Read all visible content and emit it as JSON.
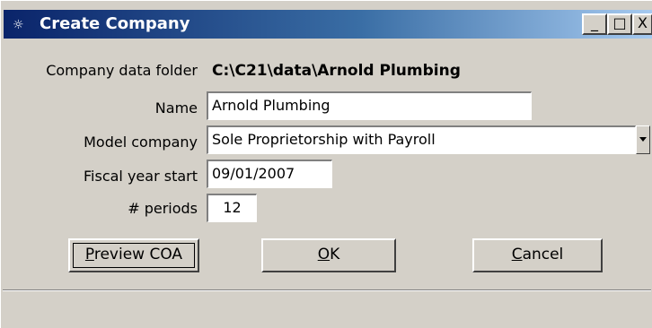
{
  "window": {
    "title": "Create Company",
    "icon": "sage-app-icon",
    "controls": {
      "minimize": "_",
      "maximize": "□",
      "close": "X"
    }
  },
  "form": {
    "folder_label": "Company data folder",
    "folder_value": "C:\\C21\\data\\Arnold Plumbing",
    "name_label": "Name",
    "name_value": "Arnold Plumbing",
    "model_label": "Model company",
    "model_value": "Sole Proprietorship with Payroll",
    "fiscal_label": "Fiscal year start",
    "fiscal_value": "09/01/2007",
    "periods_label": "# periods",
    "periods_value": "12"
  },
  "buttons": {
    "preview_mnemonic": "P",
    "preview_rest": "review COA",
    "ok_mnemonic": "O",
    "ok_rest": "K",
    "cancel_mnemonic": "C",
    "cancel_rest": "ancel"
  },
  "colors": {
    "titlebar_start": "#0a246a",
    "titlebar_end": "#a6caf0",
    "face": "#d4d0c8"
  }
}
